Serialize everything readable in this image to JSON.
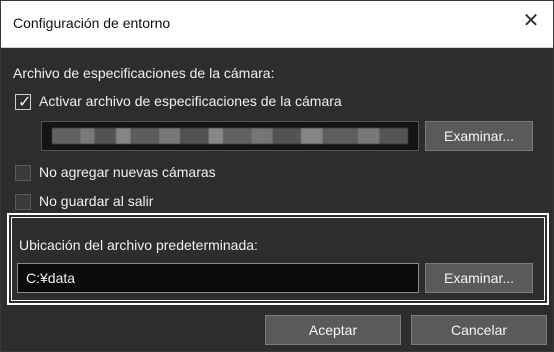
{
  "window": {
    "title": "Configuración de entorno",
    "close_glyph": "✕"
  },
  "spec_section": {
    "heading": "Archivo de especificaciones de la cámara:",
    "enable_checkbox_label": "Activar archivo de especificaciones de la cámara",
    "enable_checked": true,
    "path_value": "",
    "browse_label": "Examinar..."
  },
  "options": {
    "no_add_label": "No agregar nuevas cámaras",
    "no_add_checked": false,
    "no_save_label": "No guardar al salir",
    "no_save_checked": false
  },
  "default_location": {
    "heading": "Ubicación del archivo predeterminada:",
    "path_value": "C:¥data",
    "browse_label": "Examinar..."
  },
  "actions": {
    "ok_label": "Aceptar",
    "cancel_label": "Cancelar"
  },
  "colors": {
    "background": "#2d2d2d",
    "button": "#5a5a5a",
    "field": "#0a0a0a"
  }
}
